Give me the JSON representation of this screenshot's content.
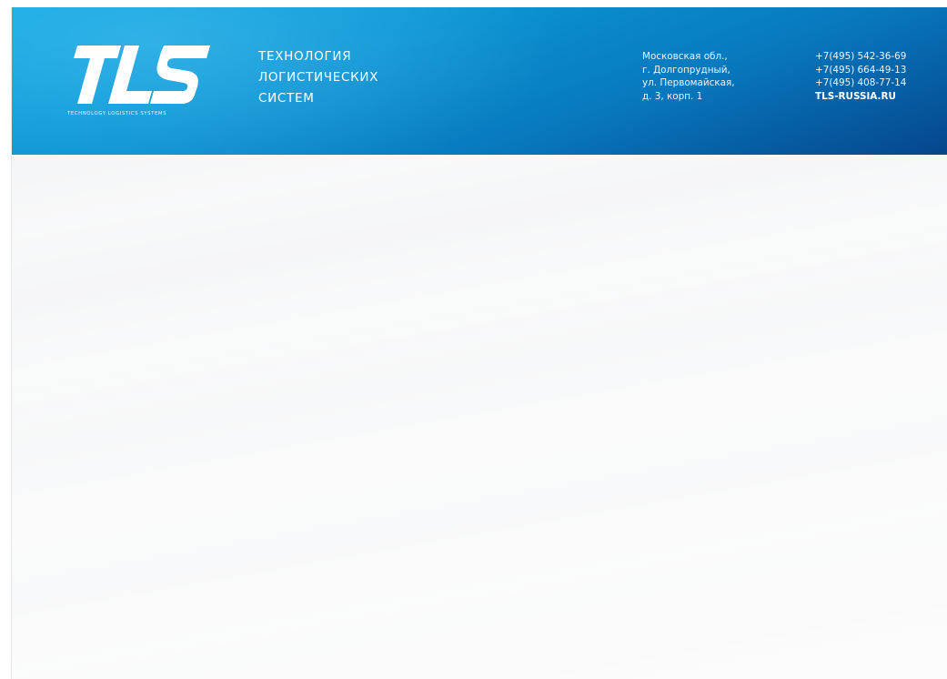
{
  "header": {
    "logo": {
      "mark": "TLS",
      "tagline": "TECHNOLOGY LOGISTICS SYSTEMS"
    },
    "company_name": [
      "ТЕХНОЛОГИЯ",
      "ЛОГИСТИЧЕСКИХ",
      "СИСТЕМ"
    ],
    "address": [
      "Московская обл.,",
      "г. Долгопрудный,",
      "ул. Первомайская,",
      "д. 3, корп. 1"
    ],
    "phones": [
      "+7(495) 542-36-69",
      "+7(495) 664-49-13",
      "+7(495) 408-77-14"
    ],
    "website": "TLS-RUSSIA.RU"
  },
  "colors": {
    "header_light": "#0aa6e0",
    "header_dark": "#05468c",
    "text_on_header": "#ffffff",
    "sheet_background": "#f5f6f7"
  }
}
